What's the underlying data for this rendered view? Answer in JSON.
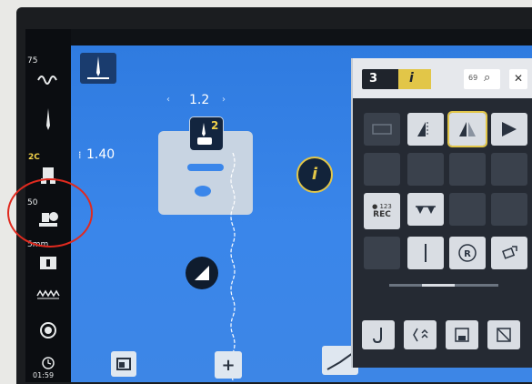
{
  "sidebar": {
    "top_value": "75",
    "label_2c": "2C",
    "label_50": "50",
    "label_sm": "5mm",
    "clock_time": "01:59"
  },
  "stitch": {
    "length_value": "1.2",
    "width_value": "1.40",
    "foot_number": "2"
  },
  "panel": {
    "tab_number": "3",
    "tab_info": "i",
    "stitch_count": "69",
    "rec_label": "REC",
    "rec_sub": "● 123"
  },
  "colors": {
    "main_blue": "#3a86ea",
    "accent_yellow": "#e2c648",
    "annotation_red": "#e02a1f"
  }
}
